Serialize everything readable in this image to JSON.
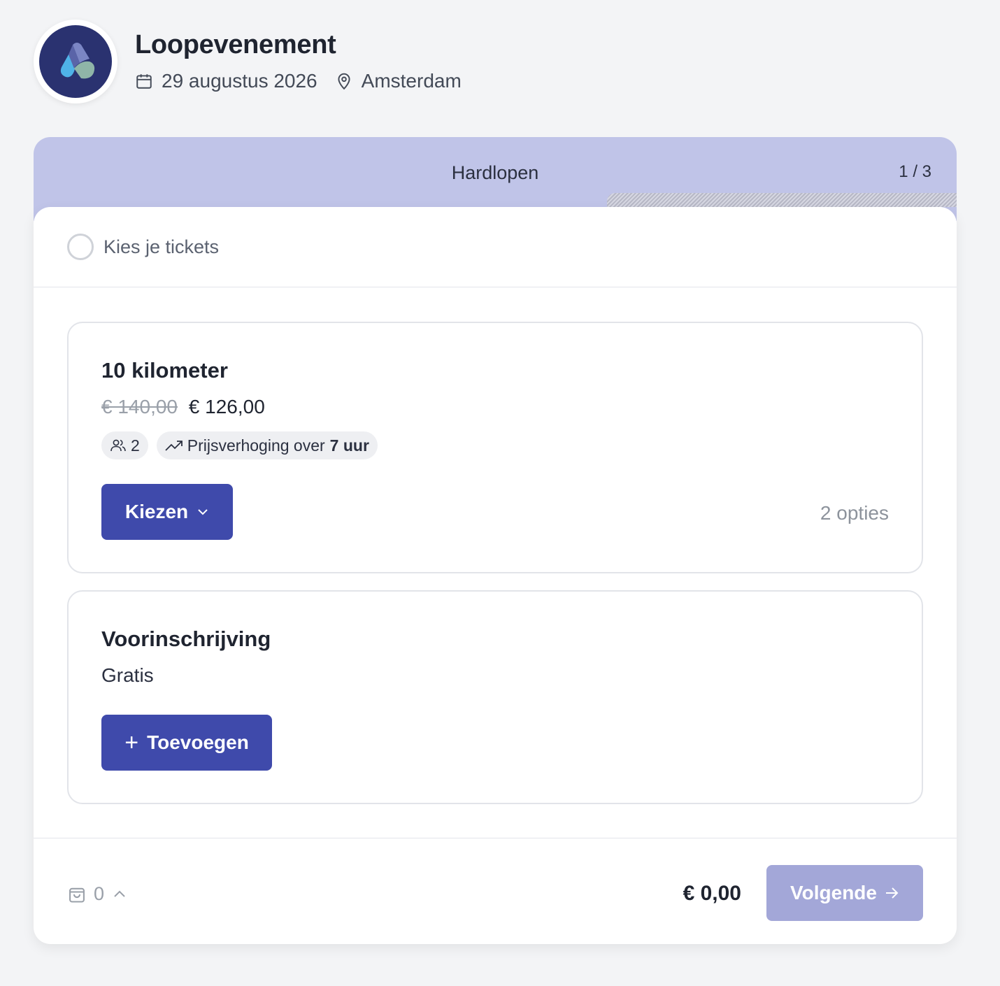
{
  "event": {
    "title": "Loopevenement",
    "date": "29 augustus 2026",
    "location": "Amsterdam",
    "logo_colors": [
      "#2a3270",
      "#7b86c4",
      "#4fb3e8",
      "#8fb5a8"
    ]
  },
  "step": {
    "title": "Hardlopen",
    "count": "1 / 3"
  },
  "section": {
    "label": "Kies je tickets"
  },
  "tickets": [
    {
      "name": "10 kilometer",
      "price_old": "€ 140,00",
      "price_new": "€ 126,00",
      "participants": "2",
      "price_increase_text": "Prijsverhoging over",
      "price_increase_time": "7 uur",
      "button_label": "Kiezen",
      "options_count": "2 opties"
    },
    {
      "name": "Voorinschrijving",
      "price": "Gratis",
      "button_label": "Toevoegen"
    }
  ],
  "footer": {
    "cart_count": "0",
    "total": "€ 0,00",
    "next_label": "Volgende"
  },
  "colors": {
    "primary": "#3f4aab",
    "primary_disabled": "#a3a7d8",
    "step_bar": "#c0c4e8"
  }
}
